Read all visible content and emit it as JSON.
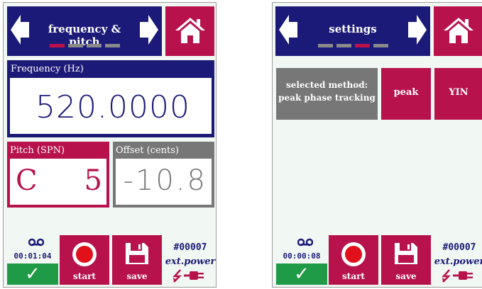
{
  "left_screen": {
    "nav": {
      "title": "frequency & pitch",
      "page_count": 4,
      "active_page": 1
    },
    "frequency": {
      "label": "Frequency (Hz)",
      "value": "520.0000"
    },
    "pitch": {
      "label": "Pitch (SPN)",
      "note": "C",
      "octave": "5"
    },
    "offset": {
      "label": "Offset (cents)",
      "value": "-10.8"
    },
    "footer": {
      "timer": "00:01:04",
      "check_glyph": "✓",
      "start_label": "start",
      "save_label": "save",
      "device_id": "#00007",
      "power_label": "ext.power"
    }
  },
  "right_screen": {
    "nav": {
      "title": "settings",
      "page_count": 4,
      "active_page": 3
    },
    "method": {
      "line1": "selected method:",
      "line2": "peak phase tracking"
    },
    "options": {
      "peak": "peak",
      "yin": "YIN"
    },
    "footer": {
      "timer": "00:00:08",
      "check_glyph": "✓",
      "start_label": "start",
      "save_label": "save",
      "device_id": "#00007",
      "power_label": "ext.power"
    }
  },
  "colors": {
    "navy": "#1c1a78",
    "crimson": "#b8124d",
    "gray": "#777777",
    "green": "#1f9a47",
    "background": "#f1f8f3"
  },
  "icons": [
    "left-arrow-icon",
    "right-arrow-icon",
    "home-icon",
    "tape-icon",
    "record-icon",
    "floppy-save-icon",
    "lightning-icon",
    "plug-icon",
    "check-icon"
  ]
}
